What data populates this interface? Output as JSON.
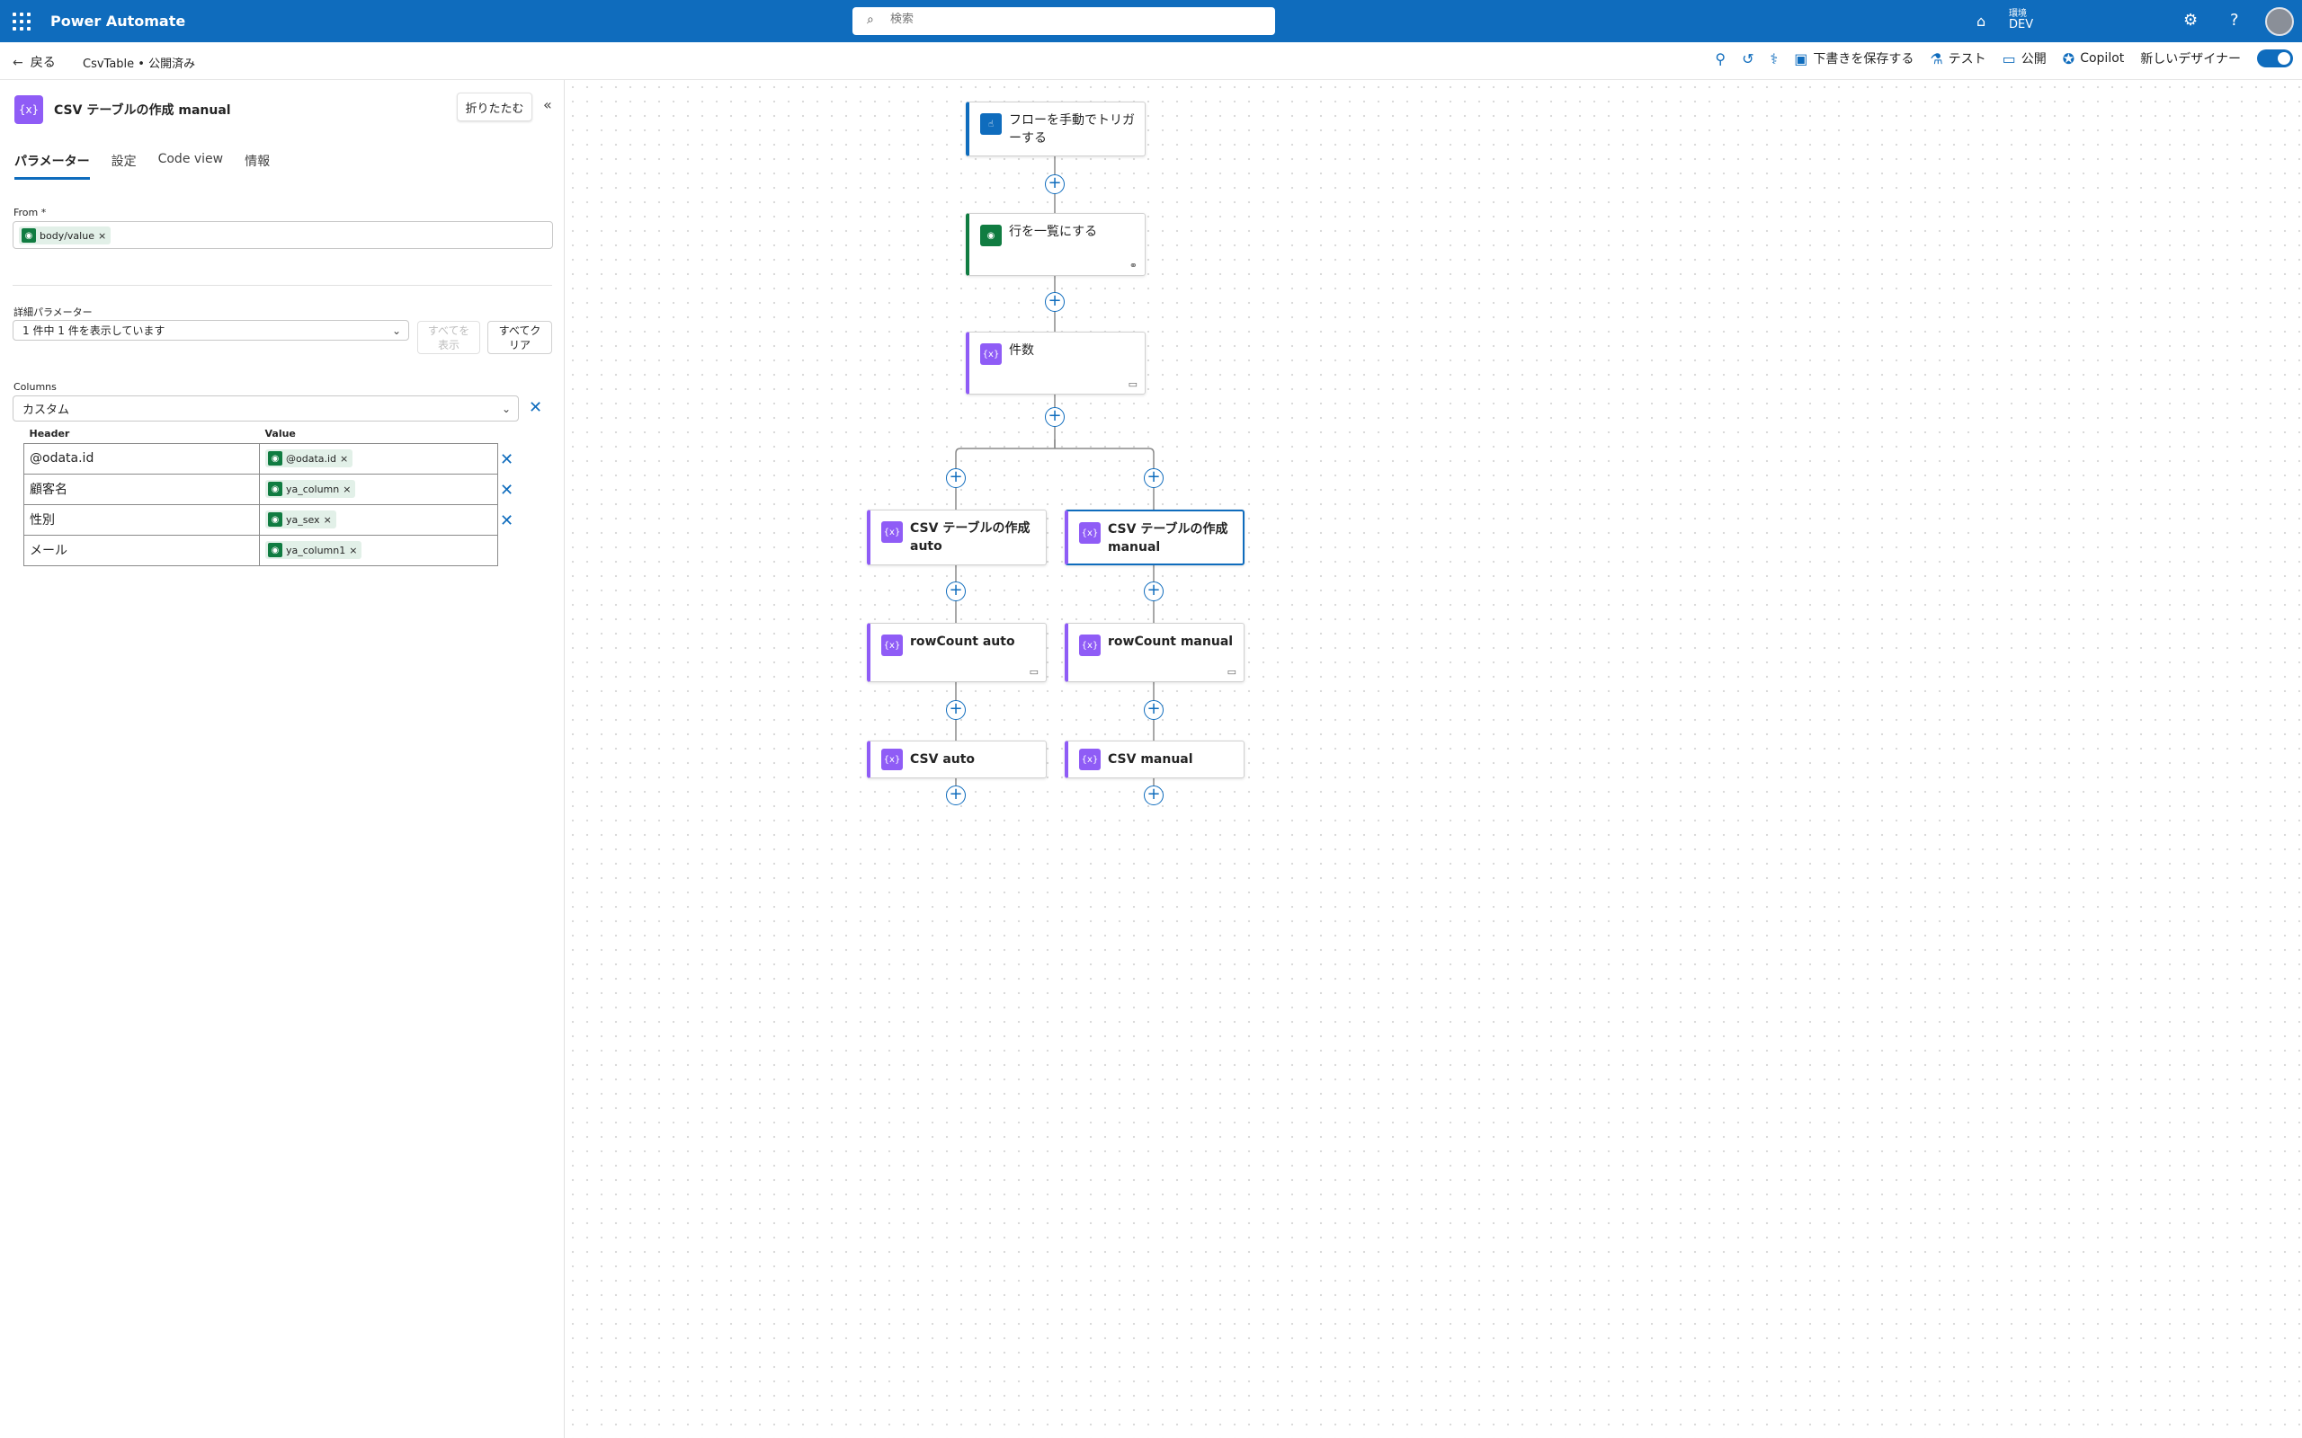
{
  "topbar": {
    "app_title": "Power Automate",
    "search_placeholder": "検索",
    "env_label": "環境",
    "env_value": "DEV",
    "icons": [
      "waffle-icon",
      "search-icon",
      "environment-icon",
      "settings-icon",
      "help-icon",
      "avatar"
    ]
  },
  "cmdbar": {
    "back_label": "戻る",
    "breadcrumb": "CsvTable • 公開済み",
    "save_draft": "下書きを保存する",
    "test": "テスト",
    "publish": "公開",
    "copilot": "Copilot",
    "new_designer": "新しいデザイナー",
    "new_designer_on": true
  },
  "panel": {
    "title": "CSV テーブルの作成 manual",
    "collapse_label": "折りたたむ",
    "tabs": [
      "パラメーター",
      "設定",
      "Code view",
      "情報"
    ],
    "active_tab": "パラメーター",
    "from_label": "From *",
    "from_token": "body/value",
    "advanced_label": "詳細パラメーター",
    "advanced_value": "1 件中 1 件を表示しています",
    "show_all_label": "すべてを表示",
    "clear_all_label": "すべてクリア",
    "columns_label": "Columns",
    "columns_value": "カスタム",
    "table_header": "Header",
    "table_value": "Value",
    "rows": [
      {
        "header": "@odata.id",
        "value": "@odata.id"
      },
      {
        "header": "顧客名",
        "value": "ya_column"
      },
      {
        "header": "性別",
        "value": "ya_sex"
      },
      {
        "header": "メール",
        "value": "ya_column1"
      }
    ]
  },
  "flow": {
    "nodes": {
      "trigger": "フローを手動でトリガーする",
      "list_rows": "行を一覧にする",
      "count": "件数",
      "csv_auto": "CSV テーブルの作成 auto",
      "csv_manual": "CSV テーブルの作成 manual",
      "rowcount_auto": "rowCount auto",
      "rowcount_manual": "rowCount manual",
      "csvout_auto": "CSV auto",
      "csvout_manual": "CSV manual"
    },
    "selected_node": "csv_manual"
  },
  "colors": {
    "brand": "#0f6cbd",
    "action_purple": "#8f5cf6",
    "connector_green": "#107c41"
  }
}
